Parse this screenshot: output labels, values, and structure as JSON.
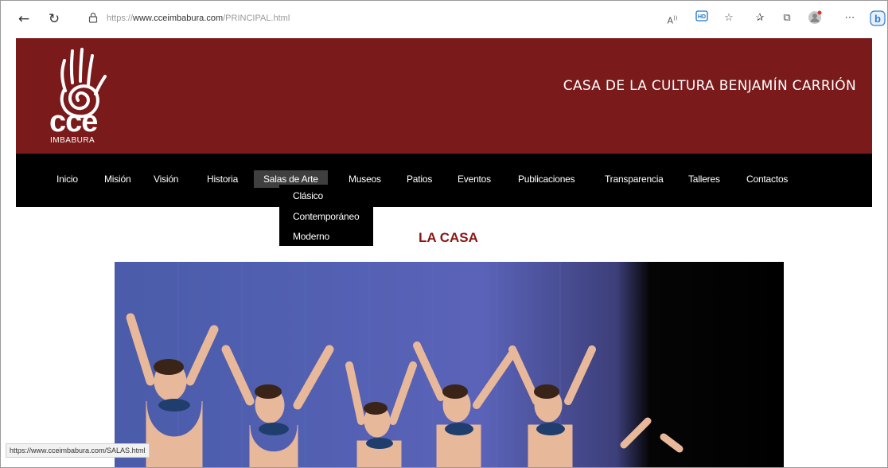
{
  "browser": {
    "url_prefix": "https://",
    "url_host": "www.cceimbabura.com",
    "url_path": "/PRINCIPAL.html",
    "status_url": "https://www.cceimbabura.com/SALAS.html"
  },
  "header": {
    "logo_text": "cce",
    "logo_subtext": "IMBABURA",
    "site_title": "CASA DE LA CULTURA BENJAMÍN CARRIÓN",
    "background_color": "#7b1a1a"
  },
  "nav": {
    "items": [
      {
        "label": "Inicio"
      },
      {
        "label": "Misión"
      },
      {
        "label": "Visión"
      },
      {
        "label": "Historia"
      },
      {
        "label": "Salas de Arte"
      },
      {
        "label": "Museos"
      },
      {
        "label": "Patios"
      },
      {
        "label": "Eventos"
      },
      {
        "label": "Publicaciones"
      },
      {
        "label": "Transparencia"
      },
      {
        "label": "Talleres"
      },
      {
        "label": "Contactos"
      }
    ],
    "active_label": "Salas de Arte"
  },
  "dropdown": {
    "items": [
      {
        "label": "Clásico"
      },
      {
        "label": "Contemporáneo"
      },
      {
        "label": "Moderno"
      }
    ]
  },
  "content": {
    "title": "LA CASA",
    "title_color": "#8b1414"
  }
}
